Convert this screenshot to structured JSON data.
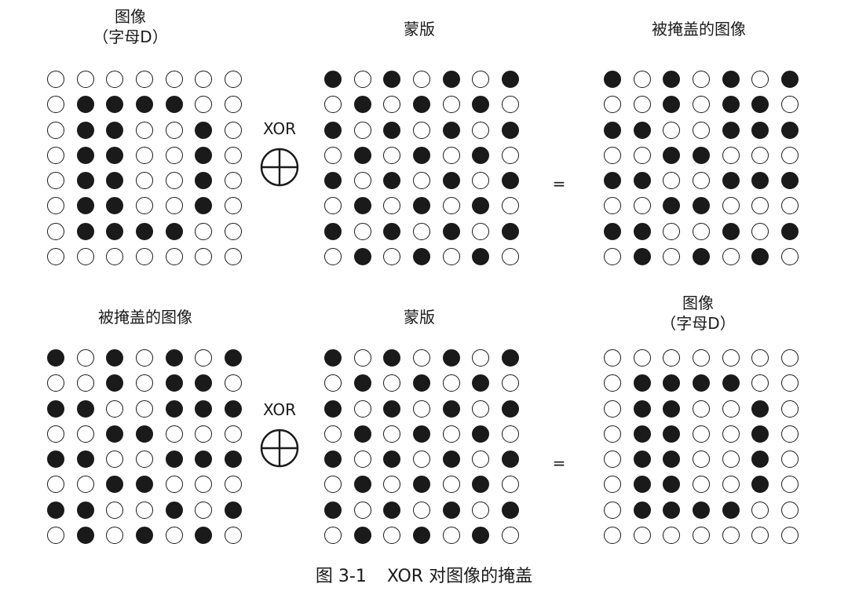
{
  "labels": {
    "top_image_line1": "图像",
    "top_image_line2": "（字母D）",
    "top_mask": "蒙版",
    "top_result": "被掩盖的图像",
    "bottom_image": "被掩盖的图像",
    "bottom_mask": "蒙版",
    "bottom_result_line1": "图像",
    "bottom_result_line2": "（字母D）"
  },
  "operators": {
    "xor_label": "XOR",
    "xor_symbol": "circled-plus-icon",
    "equals": "="
  },
  "caption": {
    "number": "图 3-1",
    "text": "XOR 对图像的掩盖"
  },
  "colors": {
    "filled": "#1a1a1a",
    "empty": "#ffffff",
    "stroke": "#1a1a1a"
  },
  "grids": {
    "letter_d": [
      [
        0,
        0,
        0,
        0,
        0,
        0,
        0
      ],
      [
        0,
        1,
        1,
        1,
        1,
        0,
        0
      ],
      [
        0,
        1,
        1,
        0,
        0,
        1,
        0
      ],
      [
        0,
        1,
        1,
        0,
        0,
        1,
        0
      ],
      [
        0,
        1,
        1,
        0,
        0,
        1,
        0
      ],
      [
        0,
        1,
        1,
        0,
        0,
        1,
        0
      ],
      [
        0,
        1,
        1,
        1,
        1,
        0,
        0
      ],
      [
        0,
        0,
        0,
        0,
        0,
        0,
        0
      ]
    ],
    "mask": [
      [
        1,
        0,
        1,
        0,
        1,
        0,
        1
      ],
      [
        0,
        1,
        0,
        1,
        0,
        1,
        0
      ],
      [
        1,
        0,
        1,
        0,
        1,
        0,
        1
      ],
      [
        0,
        1,
        0,
        1,
        0,
        1,
        0
      ],
      [
        1,
        0,
        1,
        0,
        1,
        0,
        1
      ],
      [
        0,
        1,
        0,
        1,
        0,
        1,
        0
      ],
      [
        1,
        0,
        1,
        0,
        1,
        0,
        1
      ],
      [
        0,
        1,
        0,
        1,
        0,
        1,
        0
      ]
    ],
    "masked": [
      [
        1,
        0,
        1,
        0,
        1,
        0,
        1
      ],
      [
        0,
        0,
        1,
        0,
        1,
        1,
        0
      ],
      [
        1,
        1,
        0,
        0,
        1,
        1,
        1
      ],
      [
        0,
        0,
        1,
        1,
        0,
        0,
        0
      ],
      [
        1,
        1,
        0,
        0,
        1,
        1,
        1
      ],
      [
        0,
        0,
        1,
        1,
        0,
        0,
        0
      ],
      [
        1,
        1,
        0,
        0,
        1,
        0,
        1
      ],
      [
        0,
        1,
        0,
        1,
        0,
        1,
        0
      ]
    ]
  }
}
